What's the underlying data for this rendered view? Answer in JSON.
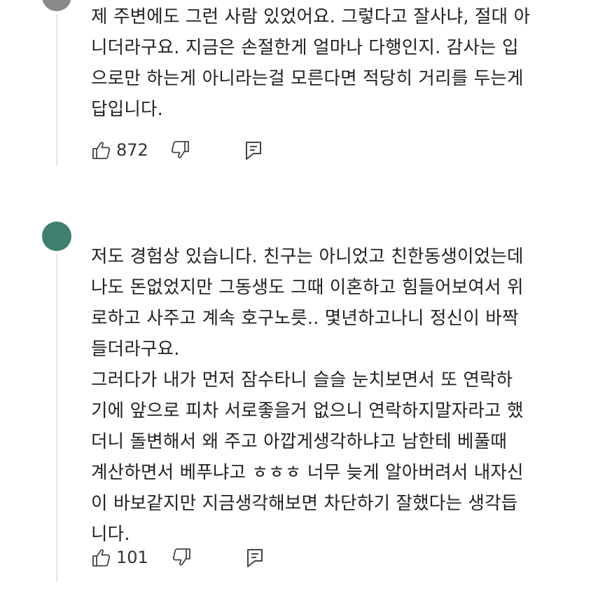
{
  "colors": {
    "avatar_1": "#8a8a8a",
    "avatar_2": "#3f7f6e",
    "text": "#222222",
    "icon": "#444444"
  },
  "comments": [
    {
      "lines": [
        "제 주변에도 그런 사람 있었어요. 그렇다고 잘사냐, 절대 아",
        "니더라구요. 지금은 손절한게 얼마나 다행인지. 감사는 입",
        "으로만 하는게 아니라는걸 모른다면 적당히 거리를 두는게",
        "답입니다."
      ],
      "likes": "872",
      "like_icon": "thumbs-up-icon",
      "dislike_icon": "thumbs-down-icon",
      "reply_icon": "reply-icon"
    },
    {
      "lines": [
        "저도 경험상 있습니다. 친구는 아니었고 친한동생이었는데",
        "나도 돈없었지만 그동생도 그때 이혼하고 힘들어보여서 위",
        "로하고 사주고  계속 호구노릇.. 몇년하고나니 정신이 바짝",
        "들더라구요.",
        "그러다가 내가 먼저 잠수타니 슬슬 눈치보면서 또 연락하",
        "기에 앞으로 피차 서로좋을거 없으니 연락하지말자라고 했",
        "더니 돌변해서  왜 주고 아깝게생각하냐고 남한테 베풀때",
        "계산하면서 베푸냐고 ㅎㅎㅎ 너무 늦게 알아버려서 내자신",
        "이 바보같지만 지금생각해보면 차단하기 잘했다는 생각듭",
        "니다."
      ],
      "likes": "101",
      "like_icon": "thumbs-up-icon",
      "dislike_icon": "thumbs-down-icon",
      "reply_icon": "reply-icon"
    }
  ]
}
